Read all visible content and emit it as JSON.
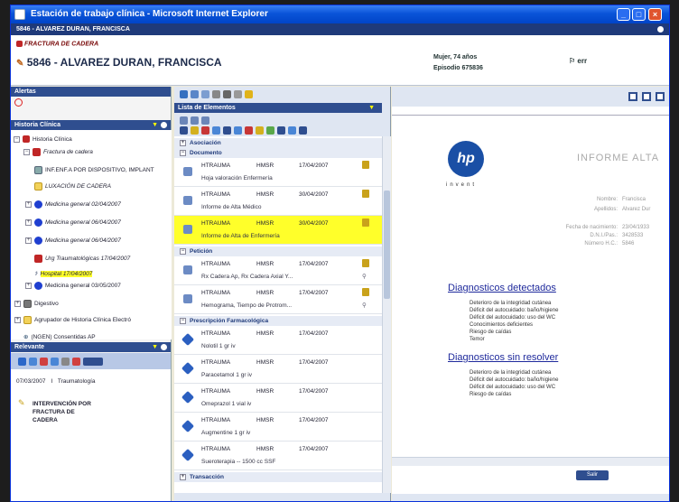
{
  "window": {
    "title": "Estación de trabajo clínica - Microsoft Internet Explorer"
  },
  "patient": {
    "bar": "5846 - ALVAREZ DURAN, FRANCISCA",
    "diagnosis": "FRACTURA DE CADERA",
    "name": "5846 - ALVAREZ DURAN, FRANCISCA",
    "sex_age": "Mujer, 74 años",
    "episode": "Episodio 675836",
    "status": "err"
  },
  "left": {
    "alerts_header": "Alertas",
    "history_header": "Historia Clínica",
    "tree": [
      {
        "label": "Historia Clínica",
        "icon": "history-icon"
      },
      {
        "label": "Fractura de cadera",
        "icon": "diagnosis-icon"
      },
      {
        "label": "INF.ENF.A POR DISPOSITIVO, IMPLANT",
        "icon": "doc-icon"
      },
      {
        "label": "LUXACIÓN DE CADERA",
        "icon": "folder-icon"
      },
      {
        "label": "Medicina general 02/04/2007",
        "icon": "blue-dot-icon"
      },
      {
        "label": "Medicina general 06/04/2007",
        "icon": "blue-dot-icon"
      },
      {
        "label": "Medicina general 06/04/2007",
        "icon": "blue-dot-icon"
      },
      {
        "label": "Urg Traumatológicas 17/04/2007",
        "icon": "red-doc-icon"
      },
      {
        "label": "Hospital 17/04/2007",
        "icon": "hospital-icon"
      },
      {
        "label": "Medicina general 03/05/2007",
        "icon": "blue-dot-icon"
      },
      {
        "label": "Digestivo",
        "icon": "folder-icon"
      },
      {
        "label": "Agrupador de Historia Clínica Electró",
        "icon": "folder-icon"
      },
      {
        "label": "(NGEN) Consentidas AP",
        "icon": "link-icon"
      }
    ],
    "relevant_header": "Relevante",
    "relevant": {
      "date": "07/03/2007",
      "sep": "I",
      "service": "Traumatología",
      "title": "INTERVENCIÓN POR FRACTURA DE CADERA"
    }
  },
  "middle": {
    "header": "Lista de Elementos",
    "sections": [
      {
        "label": "Asociación"
      },
      {
        "label": "Documento"
      },
      {
        "label": "Petición"
      },
      {
        "label": "Prescripción Farmacológica"
      },
      {
        "label": "Transacción"
      }
    ],
    "documents": [
      {
        "service": "HTRAUMA",
        "center": "HMSR",
        "date": "17/04/2007",
        "desc": "Hoja valoración Enfermería"
      },
      {
        "service": "HTRAUMA",
        "center": "HMSR",
        "date": "30/04/2007",
        "desc": "Informe de Alta Médico"
      },
      {
        "service": "HTRAUMA",
        "center": "HMSR",
        "date": "30/04/2007",
        "desc": "Informe de Alta de Enfermería"
      }
    ],
    "requests": [
      {
        "service": "HTRAUMA",
        "center": "HMSR",
        "date": "17/04/2007",
        "desc": "Rx Cadera Ap, Rx Cadera Axial Y..."
      },
      {
        "service": "HTRAUMA",
        "center": "HMSR",
        "date": "17/04/2007",
        "desc": "Hemograma, Tiempo de Protrom..."
      }
    ],
    "prescriptions": [
      {
        "service": "HTRAUMA",
        "center": "HMSR",
        "date": "17/04/2007",
        "desc": "Nolotil 1 gr iv"
      },
      {
        "service": "HTRAUMA",
        "center": "HMSR",
        "date": "17/04/2007",
        "desc": "Paracetamol 1 gr iv"
      },
      {
        "service": "HTRAUMA",
        "center": "HMSR",
        "date": "17/04/2007",
        "desc": "Omeprazol 1 vial iv"
      },
      {
        "service": "HTRAUMA",
        "center": "HMSR",
        "date": "17/04/2007",
        "desc": "Augmentine 1 gr iv"
      },
      {
        "service": "HTRAUMA",
        "center": "HMSR",
        "date": "17/04/2007",
        "desc": "Sueroterapia -- 1500 cc SSF"
      }
    ]
  },
  "report": {
    "title": "INFORME ALTA",
    "logo_text": "hp",
    "logo_sub": "invent",
    "fields": [
      {
        "label": "Nombre:",
        "value": "Francisca"
      },
      {
        "label": "Apellidos:",
        "value": "Alvarez Dur"
      },
      {
        "label": "Fecha de nacimiento:",
        "value": "23/04/1933"
      },
      {
        "label": "D.N.I./Pas.:",
        "value": "3428533"
      },
      {
        "label": "Número H.C.:",
        "value": "5846"
      }
    ],
    "detected_title": "Diagnosticos detectados",
    "detected": [
      "Deterioro de la integridad cutánea",
      "Déficit del autocuidado: baño/higiene",
      "Déficit del autocuidado: uso del WC",
      "Conocimientos deficientes",
      "Riesgo de caídas",
      "Temor"
    ],
    "unresolved_title": "Diagnosticos sin resolver",
    "unresolved": [
      "Deterioro de la integridad cutánea",
      "Déficit del autocuidado: baño/higiene",
      "Déficit del autocuidado: uso del WC",
      "Riesgo de caídas"
    ],
    "exit_button": "Salir"
  }
}
